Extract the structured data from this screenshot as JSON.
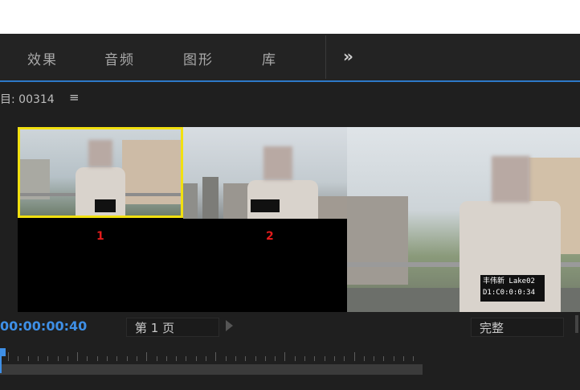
{
  "tabs": [
    "效果",
    "音频",
    "图形",
    "库"
  ],
  "more_label": "»",
  "project": {
    "title": "目: 00314",
    "menu_icon": "≡"
  },
  "clips": [
    {
      "number": "1",
      "caption_name": "",
      "caption_code": ""
    },
    {
      "number": "2",
      "caption_name": "",
      "caption_code": ""
    },
    {
      "number": "",
      "caption_name": "丰伟新 Lake02",
      "caption_code": "D1:C0:0:0:34"
    }
  ],
  "timecode": "00:00:00:40",
  "page_select": "第 1 页",
  "quality_select": "完整",
  "colors": {
    "accent": "#3e8fe6",
    "selection": "#f1e010",
    "clip_number": "#e21b1b"
  }
}
